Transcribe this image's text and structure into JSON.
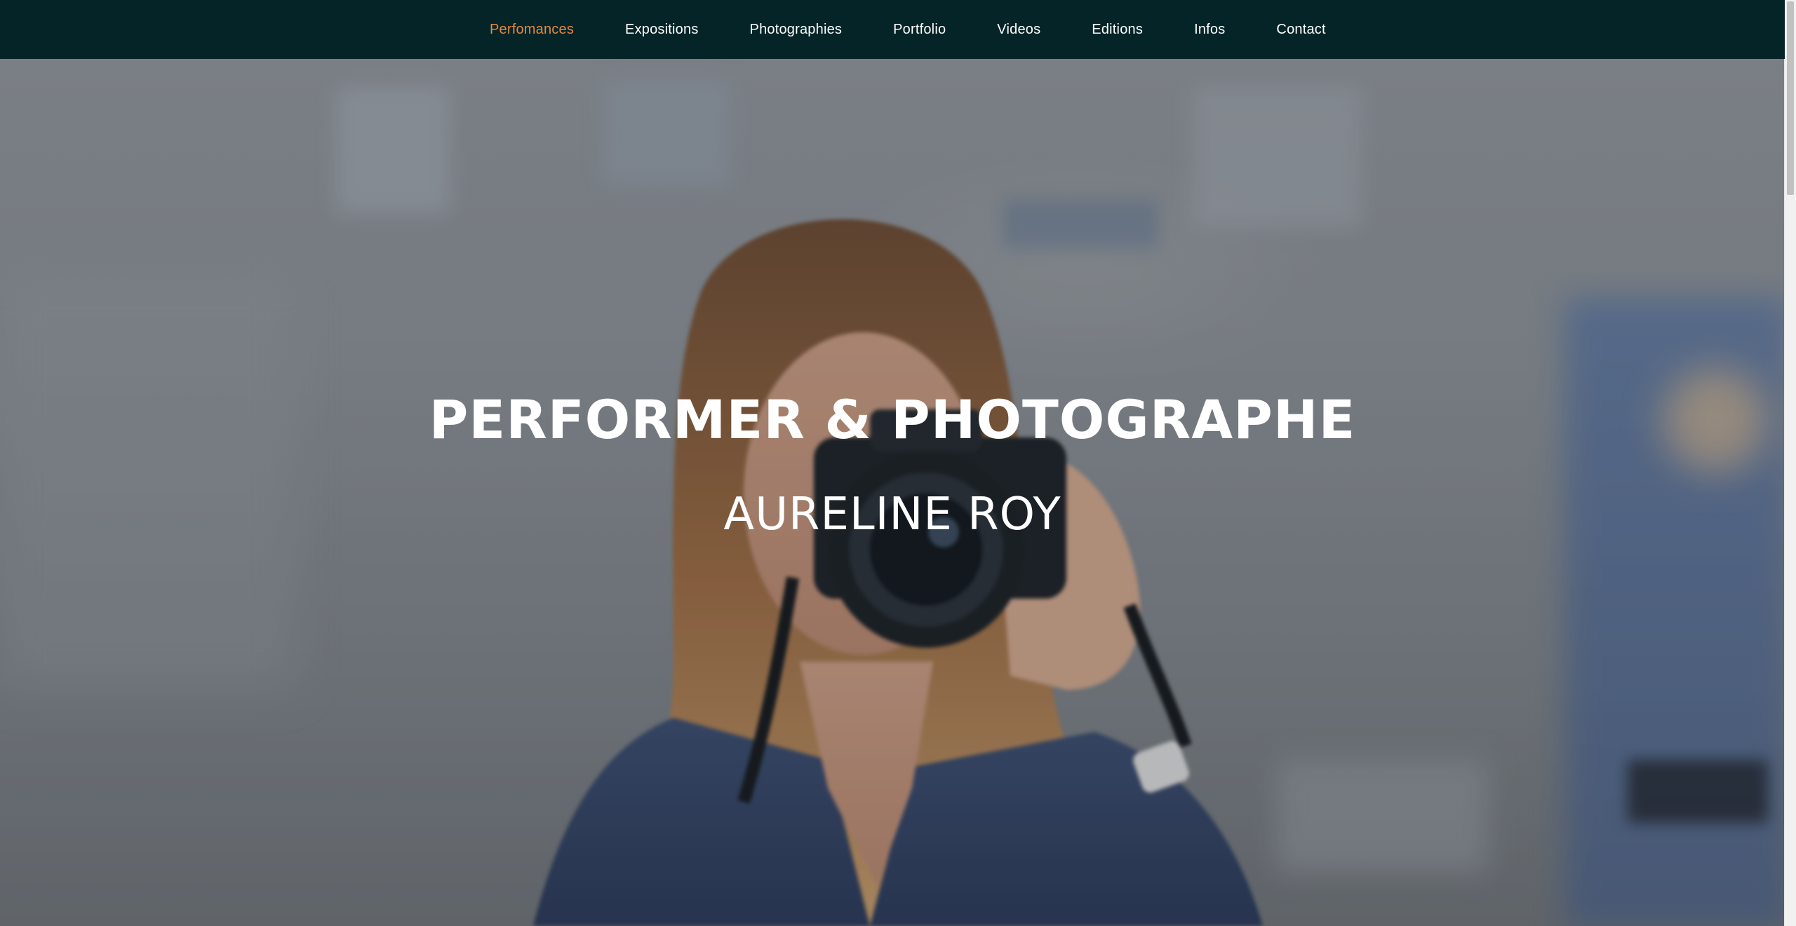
{
  "nav": {
    "items": [
      {
        "label": "Perfomances",
        "active": true
      },
      {
        "label": "Expositions",
        "active": false
      },
      {
        "label": "Photographies",
        "active": false
      },
      {
        "label": "Portfolio",
        "active": false
      },
      {
        "label": "Videos",
        "active": false
      },
      {
        "label": "Editions",
        "active": false
      },
      {
        "label": "Infos",
        "active": false
      },
      {
        "label": "Contact",
        "active": false
      }
    ],
    "background": "#042427",
    "active_color": "#e8893e"
  },
  "hero": {
    "title": "PERFORMER & PHOTOGRAPHE",
    "subtitle": "AURELINE ROY"
  }
}
